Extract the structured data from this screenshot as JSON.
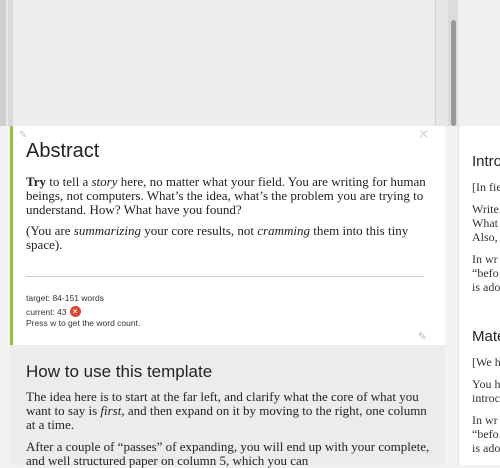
{
  "abstract": {
    "title": "Abstract",
    "p1": {
      "try": "Try",
      "a": " to tell a ",
      "story": "story",
      "b": " here, no matter what your field. You are writing for human beings, not computers. What’s the idea, what’s the problem you are trying to understand. How? What have you found?"
    },
    "p2": {
      "a": "(You are ",
      "summarizing": "summarizing",
      "b": " your core results, not ",
      "cramming": "cramming",
      "c": " them into this tiny space)."
    },
    "word_count": {
      "target": "target: 84-151 words",
      "current": "current: 43",
      "status_icon": "error-x",
      "hint": "Press w to get the word count."
    }
  },
  "howto": {
    "title": "How to use this template",
    "p1": {
      "a": "The idea here is to start at the far left, and clarify what the core of what you want to say is ",
      "first": "first",
      "b": ", and then expand on it by moving to the right, one column at a time."
    },
    "p2": "After a couple of “passes” of expanding, you will end up with your complete, and well structured paper on column 5, which you can"
  },
  "right_column": {
    "intro_heading": "Intro",
    "intro_bracket": "[In fie",
    "intro_l1": "Write",
    "intro_l2": "What",
    "intro_l3": "Also,",
    "intro_l4": "In wr",
    "intro_l5": "“befo",
    "intro_l6": "is ado",
    "mat_heading": "Mate",
    "mat_bracket": "[We h",
    "mat_l1": "You h",
    "mat_l2": "introc",
    "mat_l3": "In wr",
    "mat_l4": "“befo",
    "mat_l5": "is ado"
  },
  "icons": {
    "edit": "✎",
    "close": "×",
    "x": "×"
  },
  "colors": {
    "accent_green": "#8cc63f",
    "error_red": "#e0442c"
  }
}
